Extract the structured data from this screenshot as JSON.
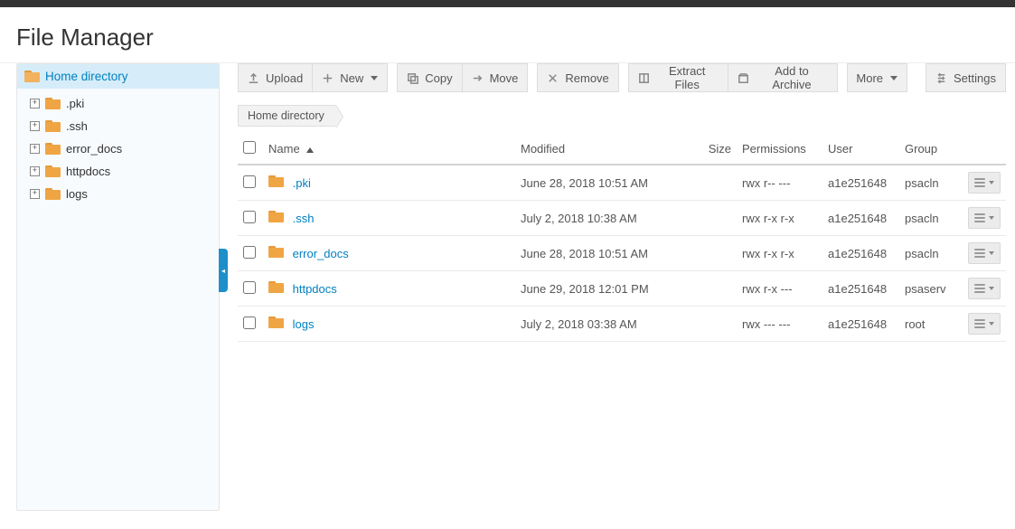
{
  "page": {
    "title": "File Manager"
  },
  "sidebar": {
    "root_label": "Home directory",
    "items": [
      {
        "label": ".pki"
      },
      {
        "label": ".ssh"
      },
      {
        "label": "error_docs"
      },
      {
        "label": "httpdocs"
      },
      {
        "label": "logs"
      }
    ]
  },
  "toolbar": {
    "upload": "Upload",
    "new": "New",
    "copy": "Copy",
    "move": "Move",
    "remove": "Remove",
    "extract": "Extract Files",
    "archive": "Add to Archive",
    "more": "More",
    "settings": "Settings"
  },
  "breadcrumb": {
    "root": "Home directory"
  },
  "columns": {
    "name": "Name",
    "modified": "Modified",
    "size": "Size",
    "permissions": "Permissions",
    "user": "User",
    "group": "Group"
  },
  "files": [
    {
      "name": ".pki",
      "modified": "June 28, 2018 10:51 AM",
      "size": "",
      "permissions": "rwx r-- ---",
      "user": "a1e251648",
      "group": "psacln"
    },
    {
      "name": ".ssh",
      "modified": "July 2, 2018 10:38 AM",
      "size": "",
      "permissions": "rwx r-x r-x",
      "user": "a1e251648",
      "group": "psacln"
    },
    {
      "name": "error_docs",
      "modified": "June 28, 2018 10:51 AM",
      "size": "",
      "permissions": "rwx r-x r-x",
      "user": "a1e251648",
      "group": "psacln"
    },
    {
      "name": "httpdocs",
      "modified": "June 29, 2018 12:01 PM",
      "size": "",
      "permissions": "rwx r-x ---",
      "user": "a1e251648",
      "group": "psaserv"
    },
    {
      "name": "logs",
      "modified": "July 2, 2018 03:38 AM",
      "size": "",
      "permissions": "rwx --- ---",
      "user": "a1e251648",
      "group": "root"
    }
  ]
}
